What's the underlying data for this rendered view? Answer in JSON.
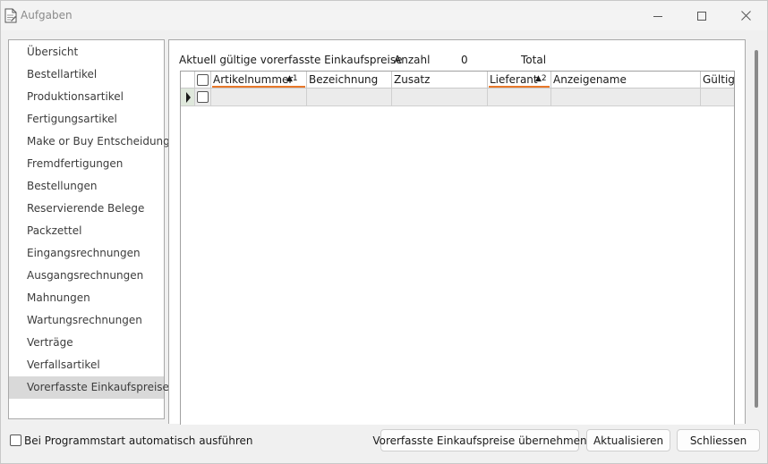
{
  "window": {
    "title": "Aufgaben",
    "minimize_glyph": "—",
    "maximize_glyph": "☐",
    "close_glyph": "✕"
  },
  "sidebar": {
    "items": [
      {
        "label": "Übersicht"
      },
      {
        "label": "Bestellartikel"
      },
      {
        "label": "Produktionsartikel"
      },
      {
        "label": "Fertigungsartikel"
      },
      {
        "label": "Make or Buy Entscheidung"
      },
      {
        "label": "Fremdfertigungen"
      },
      {
        "label": "Bestellungen"
      },
      {
        "label": "Reservierende Belege"
      },
      {
        "label": "Packzettel"
      },
      {
        "label": "Eingangsrechnungen"
      },
      {
        "label": "Ausgangsrechnungen"
      },
      {
        "label": "Mahnungen"
      },
      {
        "label": "Wartungsrechnungen"
      },
      {
        "label": "Verträge"
      },
      {
        "label": "Verfallsartikel"
      },
      {
        "label": "Vorerfasste Einkaufspreise",
        "active": true
      }
    ]
  },
  "main": {
    "heading": "Aktuell gültige vorerfasste Einkaufspreise",
    "count_label": "Anzahl",
    "count_value": "0",
    "total_label": "Total",
    "columns": [
      {
        "label": "Artikelnummer",
        "sort": "▲1"
      },
      {
        "label": "Bezeichnung"
      },
      {
        "label": "Zusatz"
      },
      {
        "label": "Lieferant",
        "sort": "▲2"
      },
      {
        "label": "Anzeigename"
      },
      {
        "label": "Gültig"
      }
    ]
  },
  "footer": {
    "autorun_label": "Bei Programmstart automatisch ausführen",
    "autorun_checked": false,
    "buttons": {
      "apply": "Vorerfasste Einkaufspreise übernehmen",
      "refresh": "Aktualisieren",
      "close": "Schliessen"
    }
  },
  "colors": {
    "sort_accent": "#e8782a",
    "selected_nav": "#d9d9d9",
    "row_indicator": "#1a1a1a"
  }
}
